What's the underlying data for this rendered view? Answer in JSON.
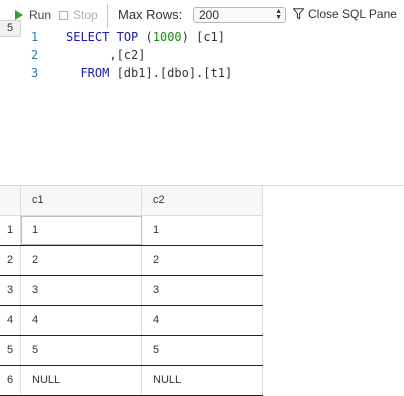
{
  "toolbar": {
    "run_label": "Run",
    "stop_label": "Stop",
    "max_rows_label": "Max Rows:",
    "max_rows_value": "200",
    "close_sql_label": "Close SQL Pane"
  },
  "editor": {
    "badge": "5",
    "line_numbers": [
      "1",
      "2",
      "3"
    ],
    "lines": [
      {
        "kw1": "SELECT",
        "kw2": "TOP",
        "open": "(",
        "num": "1000",
        "rest": ") [c1]"
      },
      {
        "text": "      ,[c2]"
      },
      {
        "kw": "FROM",
        "rest": " [db1].[dbo].[t1]"
      }
    ]
  },
  "grid": {
    "columns": [
      "c1",
      "c2"
    ],
    "rows": [
      {
        "n": "1",
        "c1": "1",
        "c2": "1"
      },
      {
        "n": "2",
        "c1": "2",
        "c2": "2"
      },
      {
        "n": "3",
        "c1": "3",
        "c2": "3"
      },
      {
        "n": "4",
        "c1": "4",
        "c2": "4"
      },
      {
        "n": "5",
        "c1": "5",
        "c2": "5"
      },
      {
        "n": "6",
        "c1": "NULL",
        "c2": "NULL"
      }
    ]
  }
}
